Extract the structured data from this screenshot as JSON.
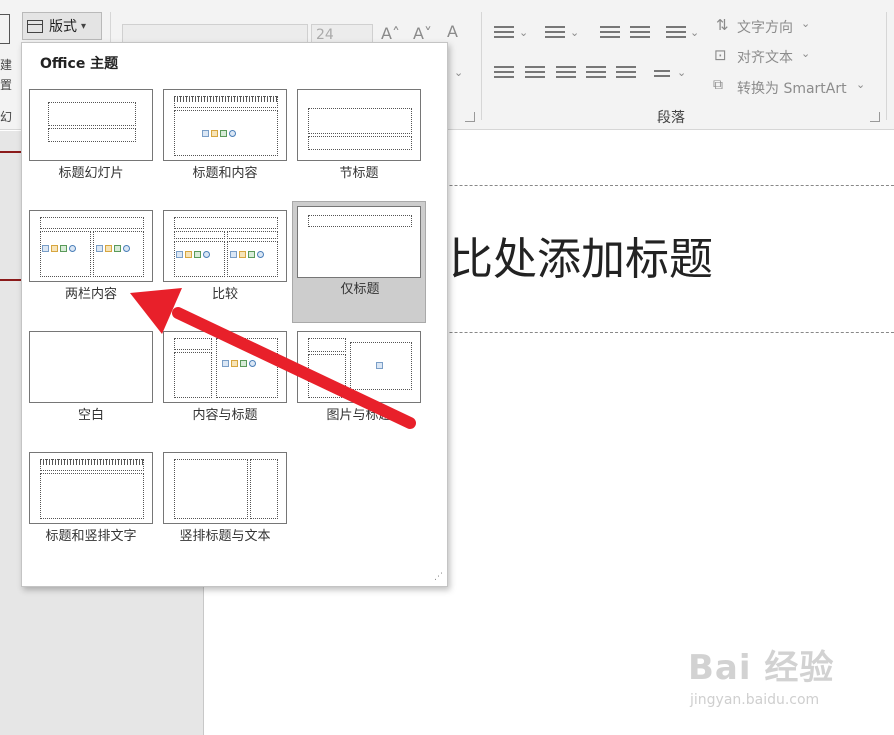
{
  "ribbon": {
    "layout_button_label": "版式",
    "left_sliver": {
      "line1": "建",
      "line2": "置",
      "group_label": "幻"
    },
    "font_size_value": "24",
    "text_direction_label": "文字方向",
    "align_text_label": "对齐文本",
    "smartart_label": "转换为 SmartArt",
    "paragraph_group_label": "段落"
  },
  "dropdown": {
    "section_title": "Office 主题",
    "layouts": [
      {
        "label": "标题幻灯片",
        "selected": false
      },
      {
        "label": "标题和内容",
        "selected": false
      },
      {
        "label": "节标题",
        "selected": false
      },
      {
        "label": "两栏内容",
        "selected": false
      },
      {
        "label": "比较",
        "selected": false
      },
      {
        "label": "仅标题",
        "selected": true
      },
      {
        "label": "空白",
        "selected": false
      },
      {
        "label": "内容与标题",
        "selected": false
      },
      {
        "label": "图片与标题",
        "selected": false
      },
      {
        "label": "标题和竖排文字",
        "selected": false
      },
      {
        "label": "竖排标题与文本",
        "selected": false
      }
    ]
  },
  "slide": {
    "title_placeholder": "比处添加标题"
  },
  "annotation": {
    "arrow_color": "#e8202a",
    "points_to": "两栏内容"
  },
  "watermark": {
    "brand": "Bai 经验",
    "url": "jingyan.baidu.com"
  },
  "colors": {
    "accent_dark_red": "#8b1a1a",
    "ribbon_bg": "#f3f3f3",
    "selected_tile": "#cdcdcd"
  }
}
